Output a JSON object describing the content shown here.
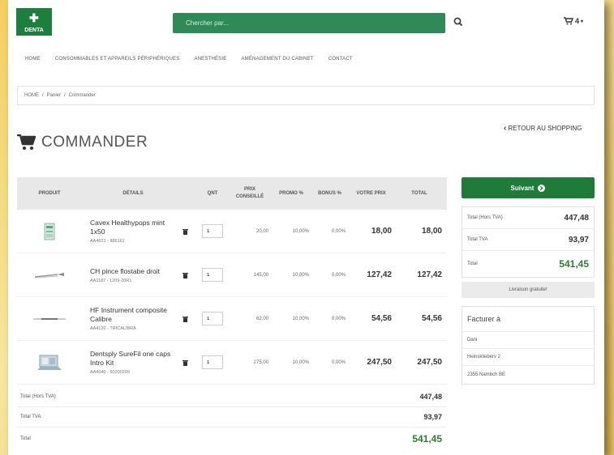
{
  "header": {
    "logo_text": "DENTA",
    "search_placeholder": "Chercher par...",
    "cart_count": "4"
  },
  "nav": [
    "HOME",
    "CONSOMMABLES ET APPAREILS PÉRIPHÉRIQUES",
    "ANESTHÉSIE",
    "AMÉNAGEMENT DU CABINET",
    "CONTACT"
  ],
  "breadcrumb": [
    "HOME",
    "Panier",
    "Commander"
  ],
  "retour_label": "RETOUR AU SHOPPING",
  "page_title": "COMMANDER",
  "table": {
    "headers": {
      "produit": "PRODUIT",
      "details": "DÉTAILS",
      "qty": "QNT",
      "prix": "PRIX CONSEILLÉ",
      "promo": "PROMO %",
      "bonus": "BONUS %",
      "votre_prix": "VOTRE PRIX",
      "total": "TOTAL"
    },
    "rows": [
      {
        "name": "Cavex Healthypops mint 1x50",
        "ref": "AA4621 - 886161",
        "qty": "1",
        "prix": "20,00",
        "promo": "10,00%",
        "bonus": "0,00%",
        "votre_prix": "18,00",
        "total": "18,00"
      },
      {
        "name": "CH pince flostabe droit",
        "ref": "AA1187 - 1209-20R1",
        "qty": "1",
        "prix": "145,00",
        "promo": "10,00%",
        "bonus": "0,00%",
        "votre_prix": "127,42",
        "total": "127,42"
      },
      {
        "name": "HF Instrument composite Calibre",
        "ref": "AA4120 - TRICALIBRA",
        "qty": "1",
        "prix": "62,00",
        "promo": "10,00%",
        "bonus": "0,00%",
        "votre_prix": "54,56",
        "total": "54,56"
      },
      {
        "name": "Dentsply SureFil one caps Intro Kit",
        "ref": "AA4040 - 60200209",
        "qty": "1",
        "prix": "275,00",
        "promo": "10,00%",
        "bonus": "0,00%",
        "votre_prix": "247,50",
        "total": "247,50"
      }
    ]
  },
  "totals": {
    "ht_label": "Total (Hors TVA)",
    "ht_value": "447,48",
    "tva_label": "Total TVA",
    "tva_value": "93,97",
    "total_label": "Total",
    "total_value": "541,45"
  },
  "right_panel": {
    "suivant_label": "Suivant",
    "livraison_label": "Livraison gratuite!",
    "facture_title": "Facturer à",
    "address": [
      "Dani",
      "Heinsklieberv 2",
      "2355 Nambch BE"
    ]
  },
  "colors": {
    "brand_green": "#1e7b3a",
    "search_green": "#2e8b57",
    "total_green": "#2e7d32"
  }
}
